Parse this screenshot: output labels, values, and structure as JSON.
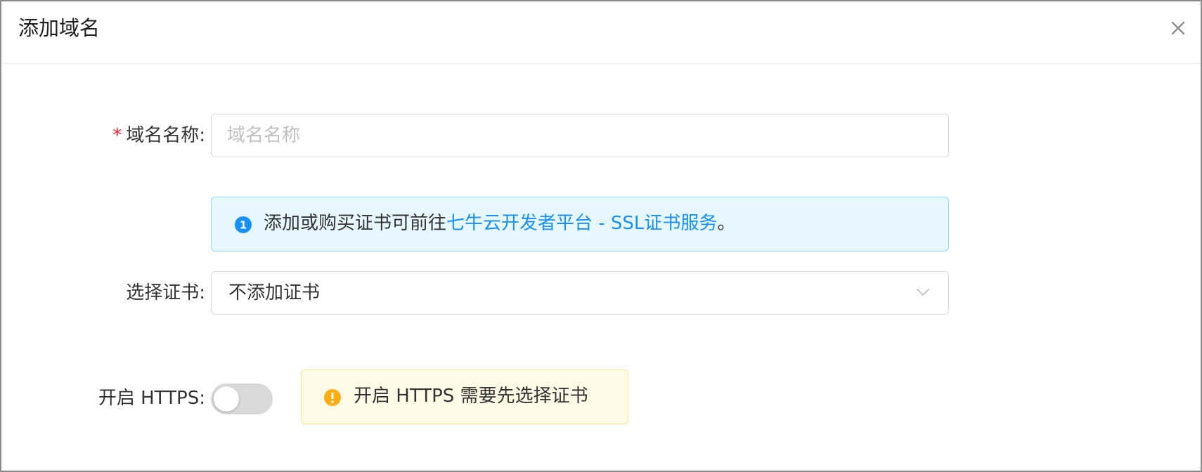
{
  "dialog": {
    "title": "添加域名",
    "close_icon": "close-icon"
  },
  "form": {
    "domain": {
      "required_mark": "*",
      "label": "域名名称:",
      "placeholder": "域名名称",
      "value": ""
    },
    "info_alert": {
      "icon": "info-icon",
      "text_prefix": "添加或购买证书可前往",
      "link_text": "七牛云开发者平台 - SSL证书服务",
      "text_suffix": "。"
    },
    "certificate": {
      "label": "选择证书:",
      "selected": "不添加证书",
      "arrow_icon": "chevron-down-icon"
    },
    "https": {
      "label": "开启 HTTPS:",
      "enabled": false,
      "warning_icon": "exclamation-icon",
      "warning_text": "开启 HTTPS 需要先选择证书"
    }
  },
  "colors": {
    "primary": "#1890ff",
    "required": "#f5222d",
    "info_bg": "#e6f7ff",
    "info_border": "#91d5ff",
    "warn_bg": "#fffbe6",
    "warn_border": "#ffe58f",
    "warn_icon": "#faad14",
    "switch_off": "#d9d9d9"
  }
}
